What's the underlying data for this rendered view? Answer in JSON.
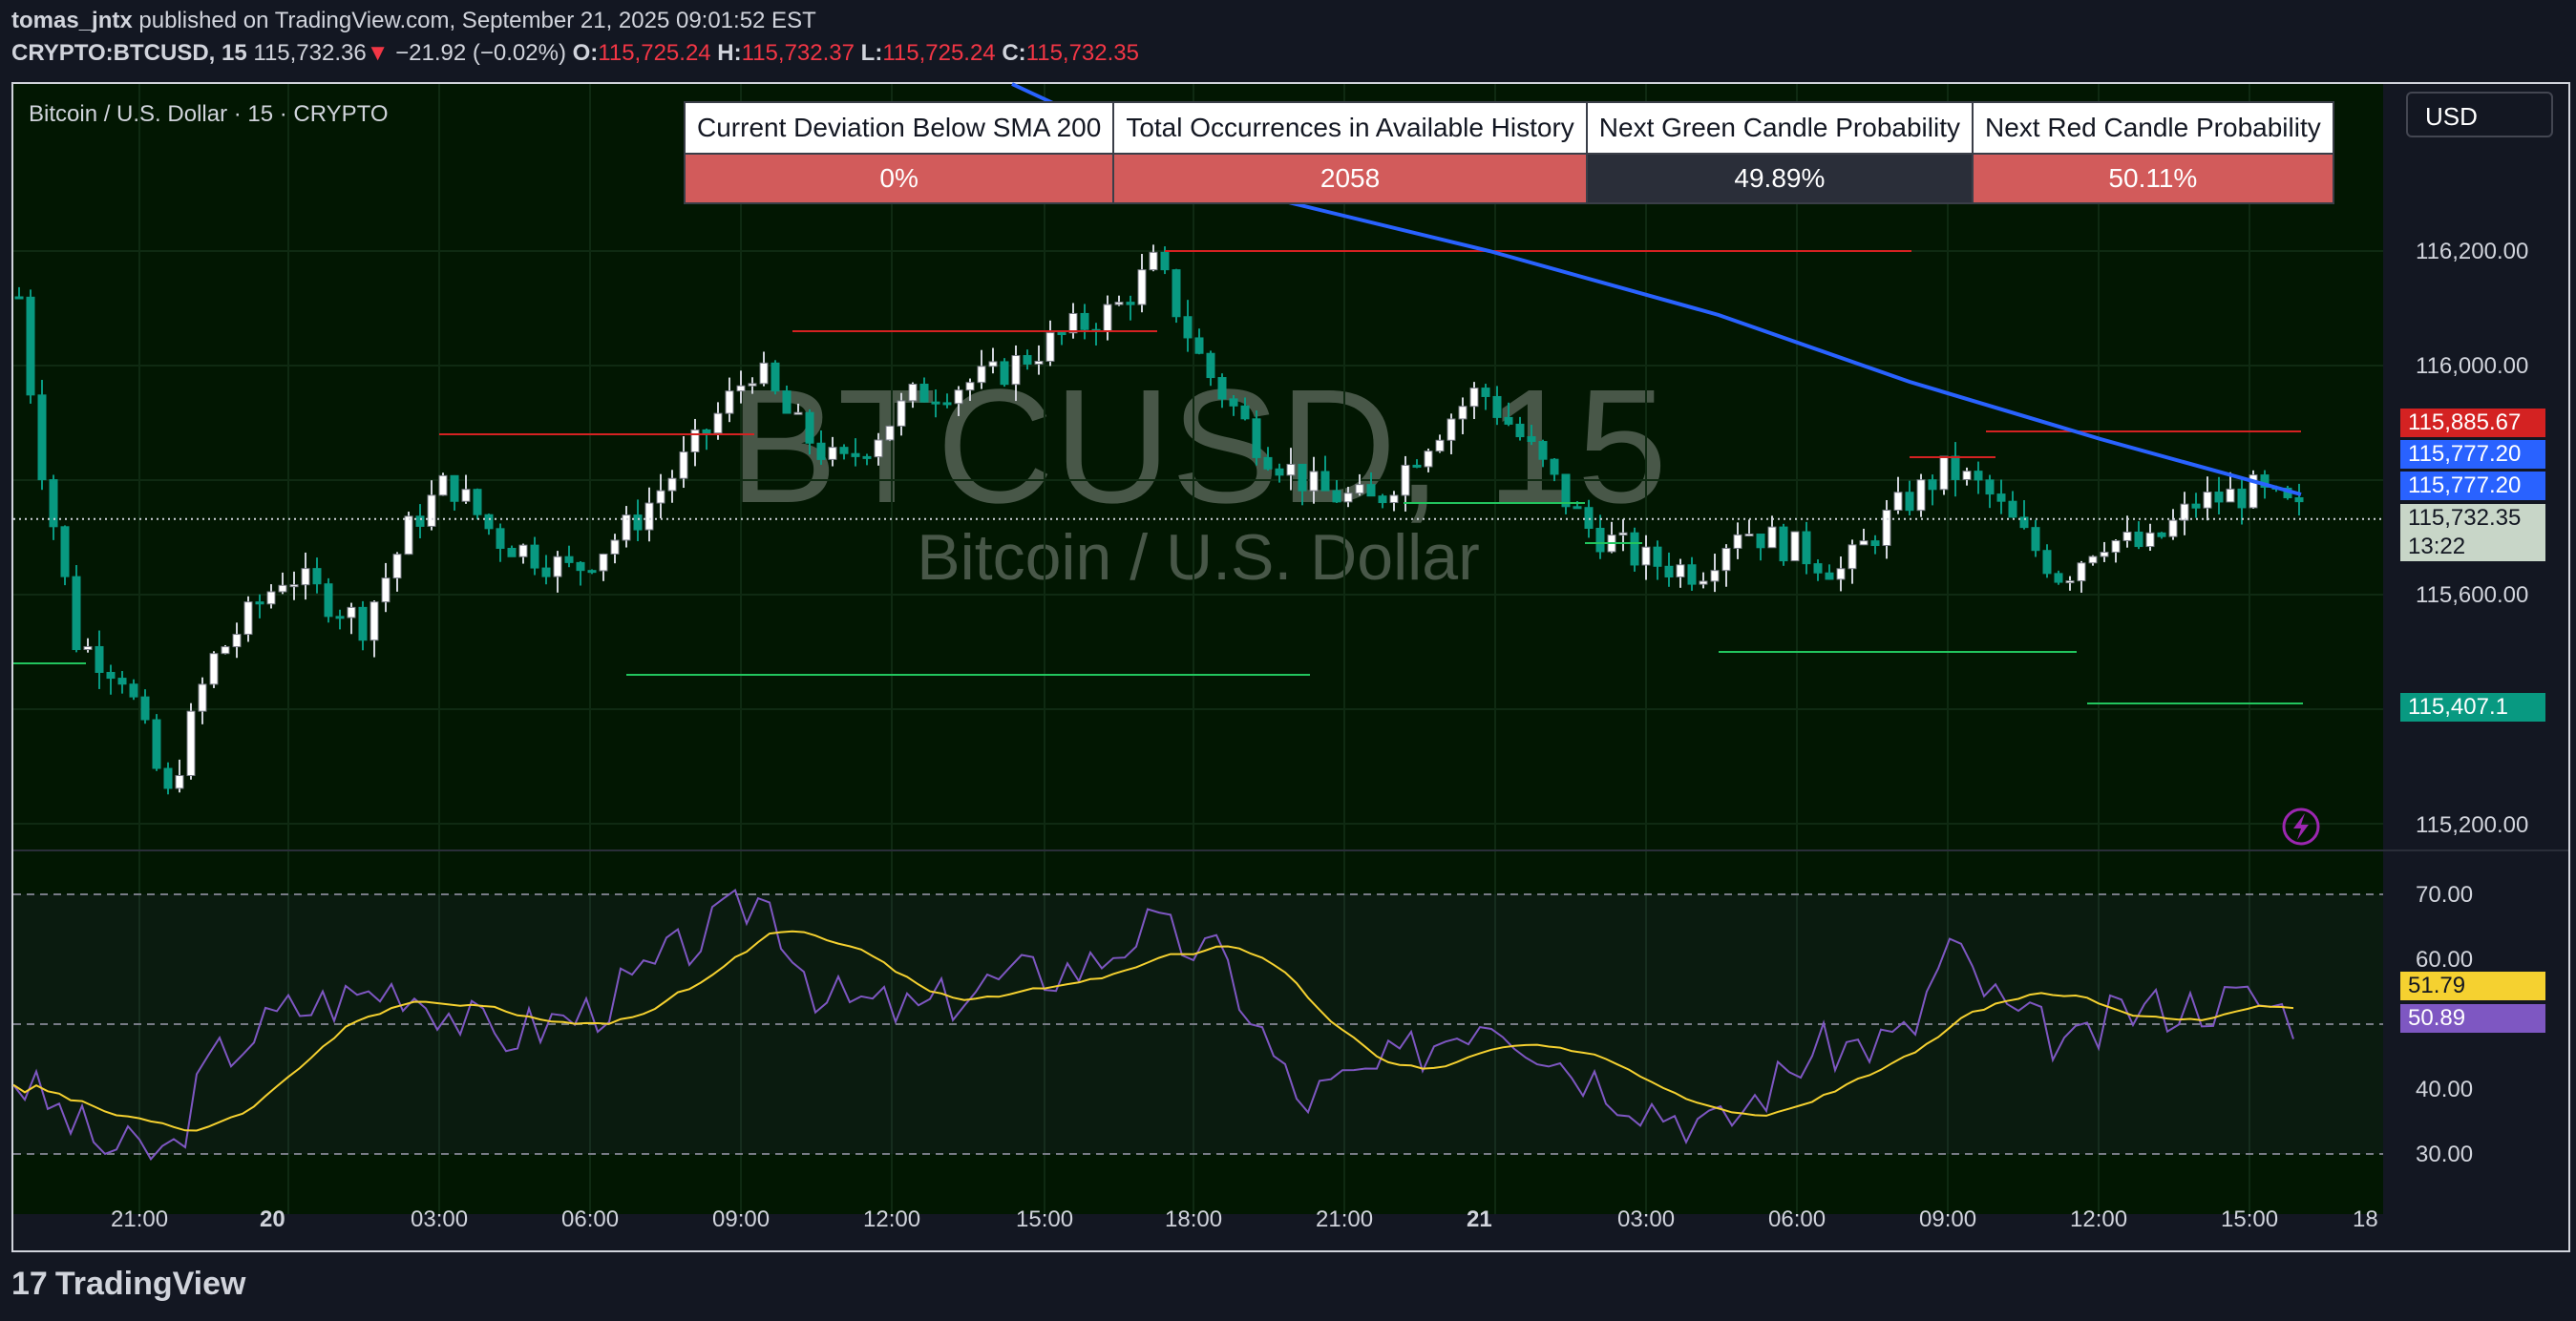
{
  "header": {
    "user": "tomas_jntx",
    "published_text": " published on TradingView.com, September 21, 2025 09:01:52 EST",
    "symbol": "CRYPTO:BTCUSD, 15",
    "last_price": " 115,732.36",
    "change": " −21.92 (−0.02%)",
    "o_label": "O:",
    "o_value": "115,725.24",
    "h_label": " H:",
    "h_value": "115,732.37",
    "l_label": " L:",
    "l_value": "115,725.24",
    "c_label": " C:",
    "c_value": "115,732.35",
    "down_arrow": "▼"
  },
  "chart": {
    "title": "Bitcoin / U.S. Dollar · 15 · CRYPTO",
    "watermark_symbol": "BTCUSD, 15",
    "watermark_name": "Bitcoin / U.S. Dollar",
    "currency": "USD"
  },
  "stats_table": {
    "headers": [
      "Current Deviation Below SMA 200",
      "Total Occurrences in Available History",
      "Next Green Candle Probability",
      "Next Red Candle Probability"
    ],
    "values": [
      "0%",
      "2058",
      "49.89%",
      "50.11%"
    ],
    "value_colors": [
      "#d25b5b",
      "#d25b5b",
      "#2a2e39",
      "#d25b5b"
    ]
  },
  "price_axis": {
    "ticks": [
      "116,200.00",
      "116,000.00",
      "115,600.00",
      "115,200.00"
    ],
    "tags": [
      {
        "label": "115,885.67",
        "color": "#d42222"
      },
      {
        "label": "115,777.20",
        "color": "#2962ff"
      },
      {
        "label": "115,777.20",
        "color": "#2962ff"
      },
      {
        "label": "115,732.35",
        "color": "#c8d6c8"
      },
      {
        "label": "13:22",
        "color": "#c8d6c8"
      },
      {
        "label": "115,407.1",
        "color": "#089981"
      }
    ]
  },
  "rsi_axis": {
    "ticks": [
      "70.00",
      "60.00",
      "40.00",
      "30.00"
    ],
    "tags": [
      {
        "label": "51.79",
        "color": "#f5d130"
      },
      {
        "label": "50.89",
        "color": "#7e57c2"
      }
    ]
  },
  "time_axis": {
    "labels": [
      "21:00",
      "20",
      "03:00",
      "06:00",
      "09:00",
      "12:00",
      "15:00",
      "18:00",
      "21:00",
      "21",
      "03:00",
      "06:00",
      "09:00",
      "12:00",
      "15:00",
      "18"
    ]
  },
  "footer": {
    "logo_mark": "17",
    "logo_text": "TradingView"
  },
  "colors": {
    "up": "#ffffff",
    "down": "#089981",
    "sma": "#2962ff",
    "rsi": "#7e57c2",
    "rsi_ma": "#f5d130",
    "resistance": "#d42222",
    "support": "#22c55e"
  }
}
